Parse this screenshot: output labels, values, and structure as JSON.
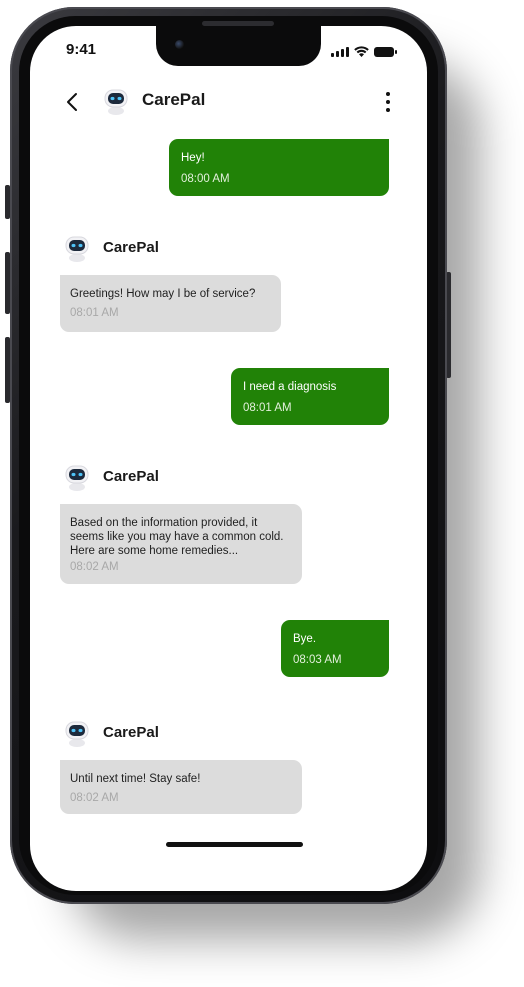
{
  "status_bar": {
    "time": "9:41"
  },
  "header": {
    "title": "CarePal"
  },
  "bot_name": "CarePal",
  "messages": [
    {
      "sender": "user",
      "text": "Hey!",
      "time": "08:00 AM"
    },
    {
      "sender": "bot",
      "text": "Greetings! How may I be of service?",
      "time": "08:01 AM"
    },
    {
      "sender": "user",
      "text": "I need a diagnosis",
      "time": "08:01 AM"
    },
    {
      "sender": "bot",
      "text": "Based on the information provided, it seems like you may have a common cold. Here are some home remedies...",
      "time": "08:02 AM"
    },
    {
      "sender": "user",
      "text": "Bye.",
      "time": "08:03 AM"
    },
    {
      "sender": "bot",
      "text": "Until next time! Stay safe!",
      "time": "08:02 AM"
    }
  ],
  "colors": {
    "user_bubble": "#218207",
    "bot_bubble": "#dcdcdc",
    "bot_time": "#a8a8a8"
  },
  "icons": {
    "back": "chevron-left-icon",
    "more": "more-vertical-icon",
    "avatar": "robot-avatar-icon"
  }
}
